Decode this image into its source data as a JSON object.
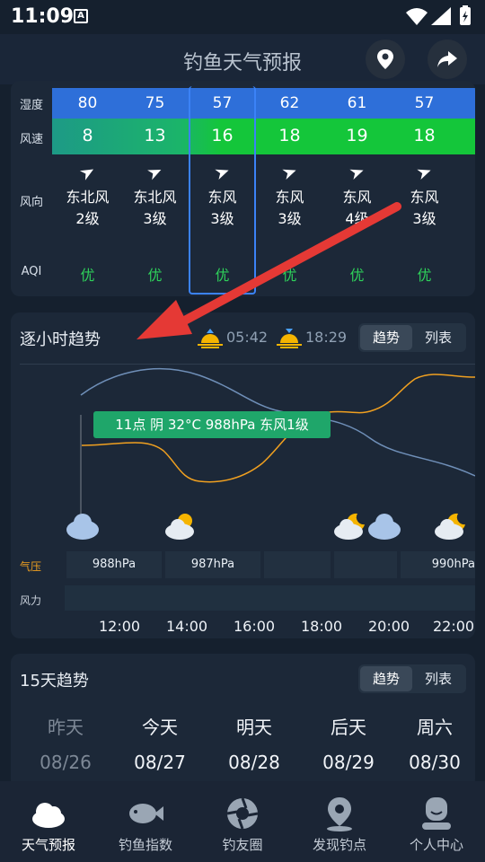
{
  "status": {
    "time": "11:09",
    "notif_icon": "A"
  },
  "appbar": {
    "title": "钓鱼天气预报",
    "location_icon": "location-pin-icon",
    "share_icon": "share-icon"
  },
  "table": {
    "labels": {
      "humidity": "湿度",
      "wind_speed": "风速",
      "wind_dir": "风向",
      "aqi": "AQI"
    },
    "columns": [
      {
        "humidity": "80",
        "wind_speed": "8",
        "dir": "东北风",
        "level": "2级",
        "aqi": "优"
      },
      {
        "humidity": "75",
        "wind_speed": "13",
        "dir": "东北风",
        "level": "3级",
        "aqi": "优"
      },
      {
        "humidity": "57",
        "wind_speed": "16",
        "dir": "东风",
        "level": "3级",
        "aqi": "优"
      },
      {
        "humidity": "62",
        "wind_speed": "18",
        "dir": "东风",
        "level": "3级",
        "aqi": "优"
      },
      {
        "humidity": "61",
        "wind_speed": "19",
        "dir": "东风",
        "level": "4级",
        "aqi": "优"
      },
      {
        "humidity": "57",
        "wind_speed": "18",
        "dir": "东风",
        "level": "3级",
        "aqi": "优"
      }
    ]
  },
  "hourly": {
    "title": "逐小时趋势",
    "sunrise": "05:42",
    "sunset": "18:29",
    "tab_trend": "趋势",
    "tab_list": "列表",
    "tooltip": "11点 阴 32°C 988hPa 东风1级",
    "pressure_label": "气压",
    "wind_label": "风力",
    "pressures": [
      "988hPa",
      "987hPa",
      "990hPa"
    ],
    "hours": [
      "12:00",
      "14:00",
      "16:00",
      "18:00",
      "20:00",
      "22:00"
    ]
  },
  "days": {
    "title": "15天趋势",
    "tab_trend": "趋势",
    "tab_list": "列表",
    "items": [
      {
        "name": "昨天",
        "date": "08/26"
      },
      {
        "name": "今天",
        "date": "08/27"
      },
      {
        "name": "明天",
        "date": "08/28"
      },
      {
        "name": "后天",
        "date": "08/29"
      },
      {
        "name": "周六",
        "date": "08/30"
      }
    ]
  },
  "nav": [
    {
      "label": "天气预报",
      "icon": "weather-cloud-icon"
    },
    {
      "label": "钓鱼指数",
      "icon": "fish-icon"
    },
    {
      "label": "钓友圈",
      "icon": "aperture-icon"
    },
    {
      "label": "发现钓点",
      "icon": "map-pin-icon"
    },
    {
      "label": "个人中心",
      "icon": "user-icon"
    }
  ],
  "colors": {
    "accent_blue": "#3b82f6",
    "green": "#2ed15a",
    "orange_line": "#f0a020",
    "tooltip_green": "#1fa66a",
    "red_arrow": "#e53935"
  }
}
